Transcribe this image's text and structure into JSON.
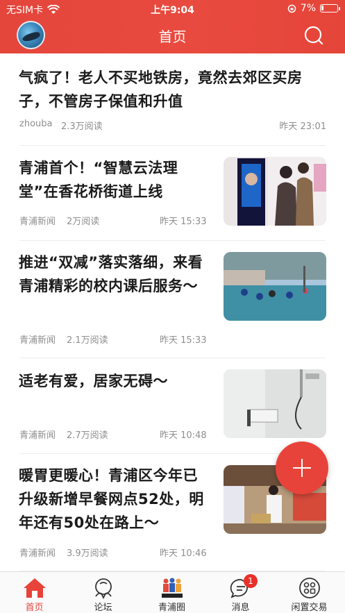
{
  "status_bar": {
    "carrier": "无SIM卡",
    "time": "上午9:04",
    "battery": "7%"
  },
  "header": {
    "title": "首页"
  },
  "articles": [
    {
      "title": "气疯了！老人不买地铁房，竟然去郊区买房子，不管房子保值和升值",
      "source": "zhouba",
      "reads": "2.3万阅读",
      "time": "昨天 23:01"
    },
    {
      "title": "青浦首个！“智慧云法理堂”在香花桥街道上线",
      "source": "青浦新闻",
      "reads": "2万阅读",
      "time": "昨天 15:33"
    },
    {
      "title": "推进“双减”落实落细，来看青浦精彩的校内课后服务～",
      "source": "青浦新闻",
      "reads": "2.1万阅读",
      "time": "昨天 15:33"
    },
    {
      "title": "适老有爱，居家无碍～",
      "source": "青浦新闻",
      "reads": "2.7万阅读",
      "time": "昨天 10:48"
    },
    {
      "title": "暖胃更暖心！青浦区今年已升级新增早餐网点52处，明年还有50处在路上～",
      "source": "青浦新闻",
      "reads": "3.9万阅读",
      "time": "昨天 10:46"
    }
  ],
  "tabs": [
    {
      "label": "首页",
      "icon": "home-icon",
      "active": true
    },
    {
      "label": "论坛",
      "icon": "forum-icon"
    },
    {
      "label": "青浦圈",
      "icon": "community-icon"
    },
    {
      "label": "消息",
      "icon": "message-icon",
      "badge": "1"
    },
    {
      "label": "闲置交易",
      "icon": "grid-icon"
    }
  ],
  "colors": {
    "brand": "#e8433a"
  }
}
